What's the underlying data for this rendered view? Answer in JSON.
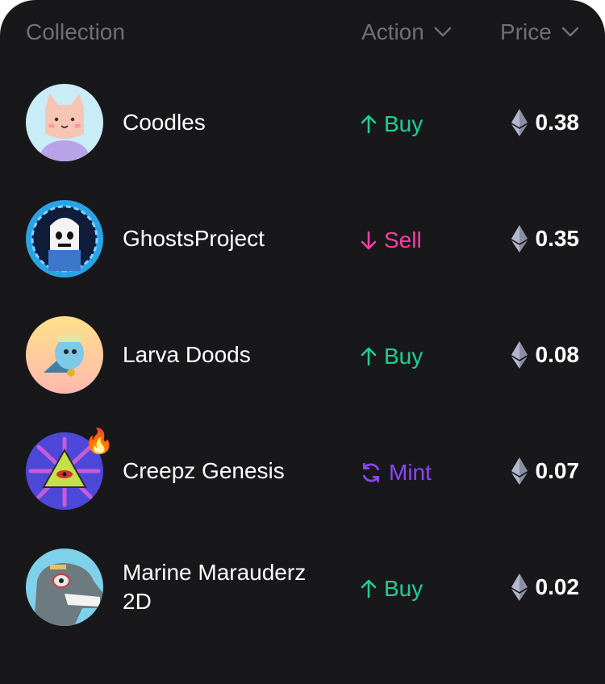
{
  "header": {
    "collection_label": "Collection",
    "action_label": "Action",
    "price_label": "Price"
  },
  "colors": {
    "background": "#18181b",
    "buy": "#1fcf95",
    "sell": "#ff3ba5",
    "mint": "#8b46f7",
    "muted": "#6f6f78"
  },
  "rows": [
    {
      "name": "Coodles",
      "action": "Buy",
      "action_type": "buy",
      "price": "0.38",
      "avatar": "coodles-avatar"
    },
    {
      "name": "GhostsProject",
      "action": "Sell",
      "action_type": "sell",
      "price": "0.35",
      "avatar": "ghostsproject-avatar"
    },
    {
      "name": "Larva Doods",
      "action": "Buy",
      "action_type": "buy",
      "price": "0.08",
      "avatar": "larva-doods-avatar"
    },
    {
      "name": "Creepz Genesis",
      "action": "Mint",
      "action_type": "mint",
      "price": "0.07",
      "avatar": "creepz-genesis-avatar",
      "badge": "🔥"
    },
    {
      "name": "Marine Marauderz 2D",
      "action": "Buy",
      "action_type": "buy",
      "price": "0.02",
      "avatar": "marine-marauderz-avatar"
    }
  ]
}
